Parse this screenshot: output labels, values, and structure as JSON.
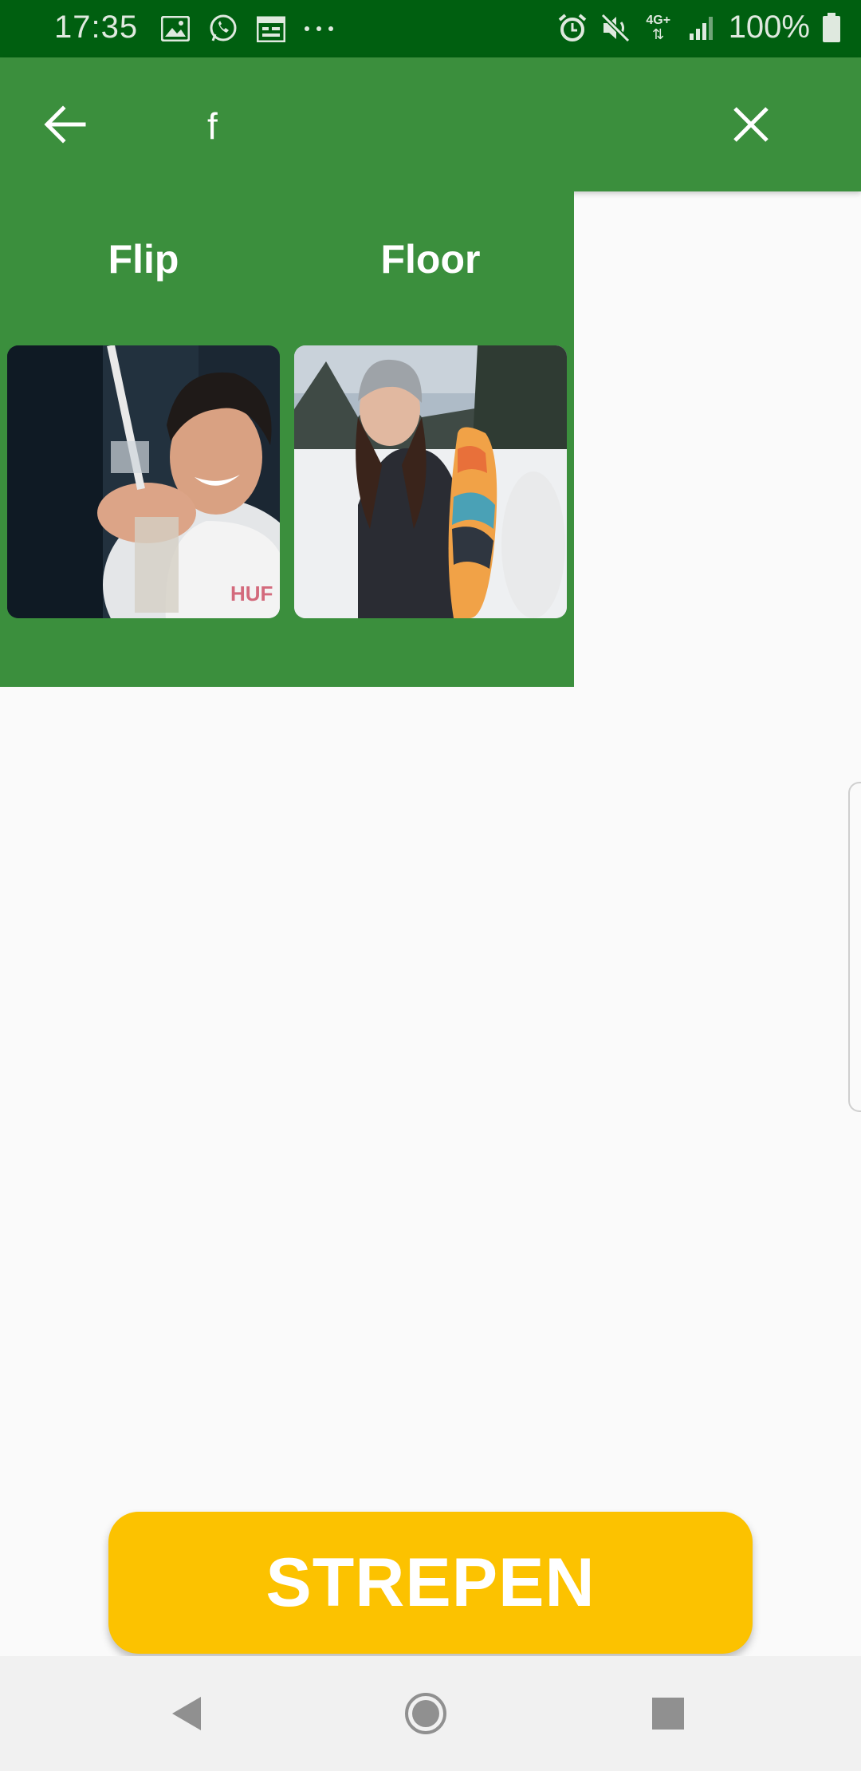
{
  "status_bar": {
    "time": "17:35",
    "battery_percent": "100%",
    "network": "4G+",
    "notification_icons": [
      "image-icon",
      "whatsapp-icon",
      "calendar-icon",
      "more-dots-icon"
    ],
    "system_icons": [
      "alarm-icon",
      "mute-icon",
      "signal-icon",
      "battery-icon"
    ]
  },
  "app_bar": {
    "query": "f",
    "color": "#3b8f3d"
  },
  "results": [
    {
      "name": "Flip"
    },
    {
      "name": "Floor"
    }
  ],
  "action": {
    "label": "STREPEN",
    "color": "#fcc200"
  },
  "nav_bar": {
    "icons": [
      "back-triangle-icon",
      "home-circle-icon",
      "recents-square-icon"
    ]
  }
}
